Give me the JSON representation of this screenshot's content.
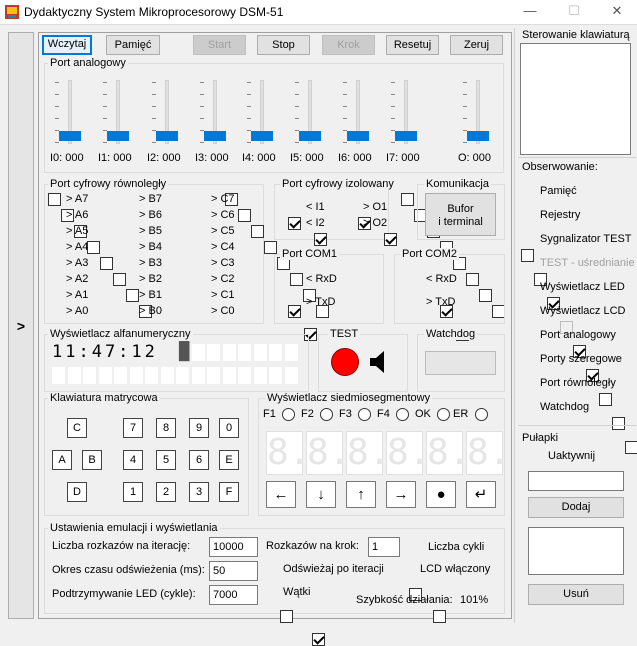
{
  "window": {
    "title": "Dydaktyczny System Mikroprocesorowy DSM-51",
    "minimize": "—",
    "maximize": "☐",
    "close": "✕"
  },
  "side_button": ">",
  "toolbar": {
    "load": "Wczytaj",
    "memory": "Pamięć",
    "start": "Start",
    "stop": "Stop",
    "step": "Krok",
    "reset": "Resetuj",
    "zero": "Zeruj"
  },
  "analog": {
    "title": "Port analogowy",
    "sliders": [
      {
        "label": "I0: 000"
      },
      {
        "label": "I1: 000"
      },
      {
        "label": "I2: 000"
      },
      {
        "label": "I3: 000"
      },
      {
        "label": "I4: 000"
      },
      {
        "label": "I5: 000"
      },
      {
        "label": "I6: 000"
      },
      {
        "label": "I7: 000"
      },
      {
        "label": "O: 000"
      }
    ]
  },
  "parallel": {
    "title": "Port cyfrowy równoległy",
    "col1": [
      "> A7",
      "> A6",
      "> A5",
      "> A4",
      "> A3",
      "> A2",
      "> A1",
      "> A0"
    ],
    "col2": [
      "> B7",
      "> B6",
      "> B5",
      "> B4",
      "> B3",
      "> B2",
      "> B1",
      "> B0"
    ],
    "col3": [
      "> C7",
      "> C6",
      "> C5",
      "> C4",
      "> C3",
      "> C2",
      "> C1",
      "> C0"
    ]
  },
  "isolated": {
    "title": "Port cyfrowy izolowany",
    "items": [
      {
        "label": "< I1",
        "checked": true
      },
      {
        "label": "> O1",
        "checked": true
      },
      {
        "label": "< I2",
        "checked": true
      },
      {
        "label": "> O2",
        "checked": true
      }
    ]
  },
  "comm": {
    "title": "Komunikacja",
    "button_line1": "Bufor",
    "button_line2": "i terminal"
  },
  "com1": {
    "title": "Port COM1",
    "rx": "< RxD",
    "tx": "> TxD"
  },
  "com2": {
    "title": "Port COM2",
    "rx": "< RxD",
    "tx": "> TxD"
  },
  "lcd": {
    "title": "Wyświetlacz alfanumeryczny",
    "line1": "11:47:12",
    "cursor": "█"
  },
  "test": {
    "title": "TEST",
    "led_color": "#ff0000"
  },
  "watchdog": {
    "title": "Watchdog"
  },
  "keypad": {
    "title": "Klawiatura matrycowa",
    "keys": [
      "C",
      "7",
      "8",
      "9",
      "0",
      "A",
      "B",
      "4",
      "5",
      "6",
      "E",
      "D",
      "1",
      "2",
      "3",
      "F"
    ]
  },
  "segments": {
    "title": "Wyświetlacz siedmiosegmentowy",
    "flags": [
      "F1",
      "F2",
      "F3",
      "F4",
      "OK",
      "ER"
    ],
    "digits": [
      "8.",
      "8.",
      "8.",
      "8.",
      "8.",
      "8."
    ],
    "arrows": [
      "←",
      "↓",
      "↑",
      "→",
      "●",
      "↵"
    ]
  },
  "emulation": {
    "title": "Ustawienia emulacji i wyświetlania",
    "iter_label": "Liczba rozkazów na iterację:",
    "iter_value": "10000",
    "refresh_label": "Okres czasu odświeżenia (ms):",
    "refresh_value": "50",
    "led_label": "Podtrzymywanie LED (cykle):",
    "led_value": "7000",
    "per_step_label": "Rozkazów na krok:",
    "per_step_value": "1",
    "cycles_label": "Liczba cykli",
    "refresh_iter_label": "Odświeżaj po iteracji",
    "lcd_on_label": "LCD włączony",
    "threads_label": "Wątki",
    "speed_label": "Szybkość działania:",
    "speed_value": "101%"
  },
  "right": {
    "keyboard_title": "Sterowanie klawiaturą",
    "observe_title": "Obserwowanie:",
    "observe": [
      {
        "label": "Pamięć",
        "checked": false,
        "disabled": false
      },
      {
        "label": "Rejestry",
        "checked": false,
        "disabled": false
      },
      {
        "label": "Sygnalizator TEST",
        "checked": true,
        "disabled": false
      },
      {
        "label": "TEST - uśrednianie",
        "checked": false,
        "disabled": true
      },
      {
        "label": "Wyświetlacz LED",
        "checked": true,
        "disabled": false
      },
      {
        "label": "Wyświetlacz LCD",
        "checked": true,
        "disabled": false
      },
      {
        "label": "Port analogowy",
        "checked": false,
        "disabled": false
      },
      {
        "label": "Porty szeregowe",
        "checked": false,
        "disabled": false
      },
      {
        "label": "Port równoległy",
        "checked": false,
        "disabled": false
      },
      {
        "label": "Watchdog",
        "checked": true,
        "disabled": false
      }
    ],
    "traps_title": "Pułapki",
    "activate": "Uaktywnij",
    "add": "Dodaj",
    "remove": "Usuń"
  }
}
